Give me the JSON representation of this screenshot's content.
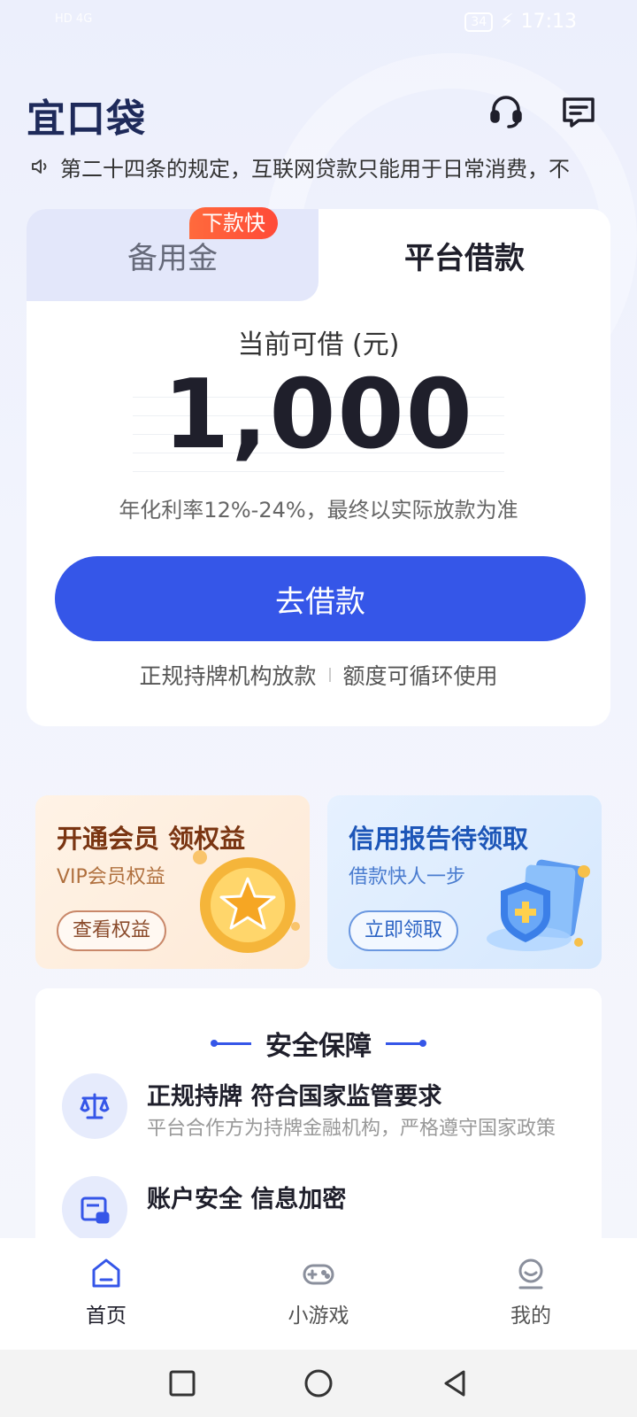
{
  "status_bar": {
    "signal": "HD 4G",
    "battery": "34",
    "time": "17:13"
  },
  "header": {
    "logo": "宜口袋",
    "service_icon": "headset-icon",
    "message_icon": "message-icon"
  },
  "notice": {
    "icon": "speaker-icon",
    "text": "第二十四条的规定，互联网贷款只能用于日常消费，不"
  },
  "loan_card": {
    "tabs": [
      {
        "label": "备用金",
        "active": false
      },
      {
        "label": "平台借款",
        "active": true
      }
    ],
    "fast_badge": "下款快",
    "available_label": "当前可借 (元)",
    "amount": "1,000",
    "rate_text": "年化利率12%-24%，最终以实际放款为准",
    "borrow_button": "去借款",
    "features": [
      "正规持牌机构放款",
      "额度可循环使用"
    ]
  },
  "promos": [
    {
      "title": "开通会员 领权益",
      "subtitle": "VIP会员权益",
      "button": "查看权益"
    },
    {
      "title": "信用报告待领取",
      "subtitle": "借款快人一步",
      "button": "立即领取"
    }
  ],
  "security": {
    "title": "安全保障",
    "items": [
      {
        "title": "正规持牌 符合国家监管要求",
        "desc": "平台合作方为持牌金融机构，严格遵守国家政策",
        "icon": "scale-icon"
      },
      {
        "title": "账户安全 信息加密",
        "desc": "",
        "icon": "secure-card-icon"
      }
    ]
  },
  "bottom_nav": [
    {
      "label": "首页",
      "icon": "home-icon",
      "active": true
    },
    {
      "label": "小游戏",
      "icon": "gamepad-icon",
      "active": false
    },
    {
      "label": "我的",
      "icon": "profile-icon",
      "active": false
    }
  ],
  "colors": {
    "primary": "#3556e8",
    "badge": "#ff5a3a",
    "text_dark": "#1f1f2b"
  }
}
